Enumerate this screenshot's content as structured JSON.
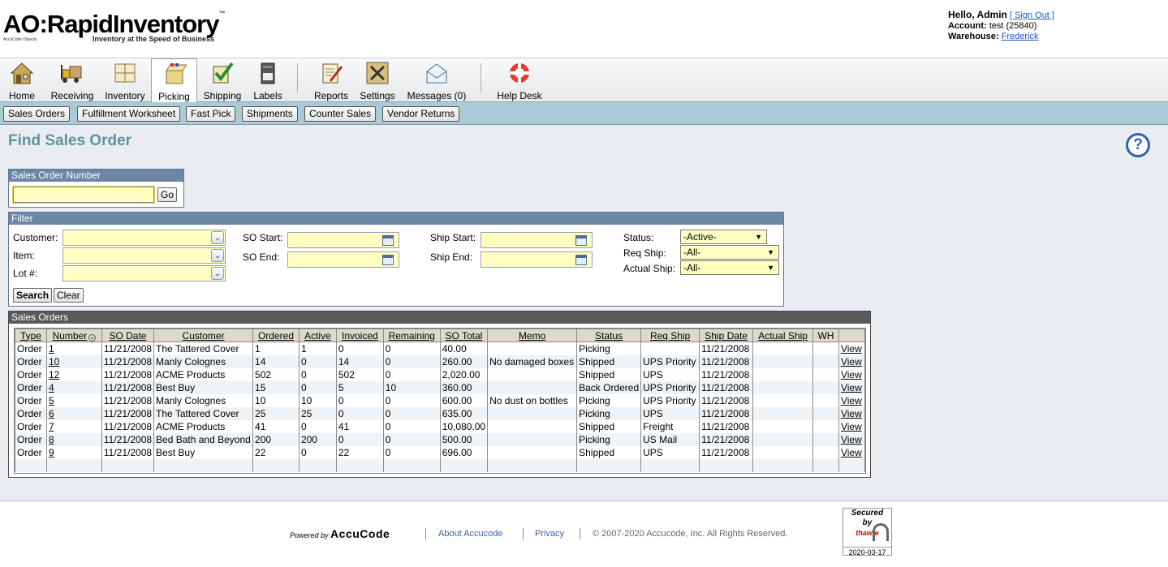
{
  "header": {
    "logo_text": "AO:RapidInventory",
    "logo_tm": "™",
    "logo_tagline": "Inventory at the Speed of Business",
    "logo_sub": "AccuCode Objects",
    "greeting": "Hello, Admin",
    "sign_out": "[ Sign Out ]",
    "account_label": "Account:",
    "account_value": "test (25840)",
    "warehouse_label": "Warehouse:",
    "warehouse_value": "Frederick"
  },
  "nav": {
    "items": [
      {
        "label": "Home",
        "icon": "house-icon"
      },
      {
        "label": "Receiving",
        "icon": "forklift-icon"
      },
      {
        "label": "Inventory",
        "icon": "shelves-icon"
      },
      {
        "label": "Picking",
        "icon": "box-icon",
        "active": true
      },
      {
        "label": "Shipping",
        "icon": "checkbox-icon"
      },
      {
        "label": "Labels",
        "icon": "printer-icon"
      },
      {
        "label": "Reports",
        "icon": "report-pen-icon"
      },
      {
        "label": "Settings",
        "icon": "tools-icon"
      },
      {
        "label": "Messages (0)",
        "icon": "envelope-icon"
      },
      {
        "label": "Help Desk",
        "icon": "lifebuoy-icon"
      }
    ]
  },
  "subnav": {
    "buttons": [
      "Sales Orders",
      "Fulfillment Worksheet",
      "Fast Pick",
      "Shipments",
      "Counter Sales",
      "Vendor Returns"
    ]
  },
  "main": {
    "title": "Find Sales Order",
    "help": "?",
    "so_number": {
      "header": "Sales Order Number",
      "value": "",
      "go_label": "Go"
    },
    "filter": {
      "header": "Filter",
      "customer_label": "Customer:",
      "item_label": "Item:",
      "lot_label": "Lot #:",
      "so_start_label": "SO Start:",
      "so_end_label": "SO End:",
      "ship_start_label": "Ship Start:",
      "ship_end_label": "Ship End:",
      "status_label": "Status:",
      "status_value": "-Active-",
      "req_ship_label": "Req Ship:",
      "req_ship_value": "-All-",
      "actual_ship_label": "Actual Ship:",
      "actual_ship_value": "-All-",
      "search_label": "Search",
      "clear_label": "Clear"
    },
    "orders": {
      "header": "Sales Orders",
      "columns": [
        "Type",
        "Number",
        "SO Date",
        "Customer",
        "Ordered",
        "Active",
        "Invoiced",
        "Remaining",
        "SO Total",
        "Memo",
        "Status",
        "Req Ship",
        "Ship Date",
        "Actual Ship",
        "WH",
        ""
      ],
      "sort_indicator": "⌄",
      "rows": [
        [
          "Order",
          "1",
          "11/21/2008",
          "The Tattered Cover",
          "1",
          "1",
          "0",
          "0",
          "40.00",
          "",
          "Picking",
          "",
          "11/21/2008",
          "",
          "",
          "View"
        ],
        [
          "Order",
          "10",
          "11/21/2008",
          "Manly Colognes",
          "14",
          "0",
          "14",
          "0",
          "260.00",
          "No damaged boxes",
          "Shipped",
          "UPS Priority",
          "11/21/2008",
          "",
          "",
          "View"
        ],
        [
          "Order",
          "12",
          "11/21/2008",
          "ACME Products",
          "502",
          "0",
          "502",
          "0",
          "2,020.00",
          "",
          "Shipped",
          "UPS",
          "11/21/2008",
          "",
          "",
          "View"
        ],
        [
          "Order",
          "4",
          "11/21/2008",
          "Best Buy",
          "15",
          "0",
          "5",
          "10",
          "360.00",
          "",
          "Back Ordered",
          "UPS Priority",
          "11/21/2008",
          "",
          "",
          "View"
        ],
        [
          "Order",
          "5",
          "11/21/2008",
          "Manly Colognes",
          "10",
          "10",
          "0",
          "0",
          "600.00",
          "No dust on bottles",
          "Picking",
          "UPS Priority",
          "11/21/2008",
          "",
          "",
          "View"
        ],
        [
          "Order",
          "6",
          "11/21/2008",
          "The Tattered Cover",
          "25",
          "25",
          "0",
          "0",
          "635.00",
          "",
          "Picking",
          "UPS",
          "11/21/2008",
          "",
          "",
          "View"
        ],
        [
          "Order",
          "7",
          "11/21/2008",
          "ACME Products",
          "41",
          "0",
          "41",
          "0",
          "10,080.00",
          "",
          "Shipped",
          "Freight",
          "11/21/2008",
          "",
          "",
          "View"
        ],
        [
          "Order",
          "8",
          "11/21/2008",
          "Bed Bath and Beyond",
          "200",
          "200",
          "0",
          "0",
          "500.00",
          "",
          "Picking",
          "US Mail",
          "11/21/2008",
          "",
          "",
          "View"
        ],
        [
          "Order",
          "9",
          "11/21/2008",
          "Best Buy",
          "22",
          "0",
          "22",
          "0",
          "696.00",
          "",
          "Shipped",
          "UPS",
          "11/21/2008",
          "",
          "",
          "View"
        ]
      ]
    }
  },
  "footer": {
    "powered_by": "Powered by",
    "brand": "AccuCode",
    "about": "About Accucode",
    "privacy": "Privacy",
    "copyright": "© 2007-2020 Accucode, Inc. All Rights Reserved.",
    "seal_line1": "Secured",
    "seal_line2": "by",
    "seal_line3": "thawte",
    "seal_date": "2020-03-17"
  },
  "colors": {
    "title": "#5e9694",
    "panel_header": "#6c86a6",
    "orders_header": "#5a5a5a",
    "subnav_bg": "#a9cad6",
    "input_bg": "#ffffc2",
    "link": "#1a56c8"
  }
}
